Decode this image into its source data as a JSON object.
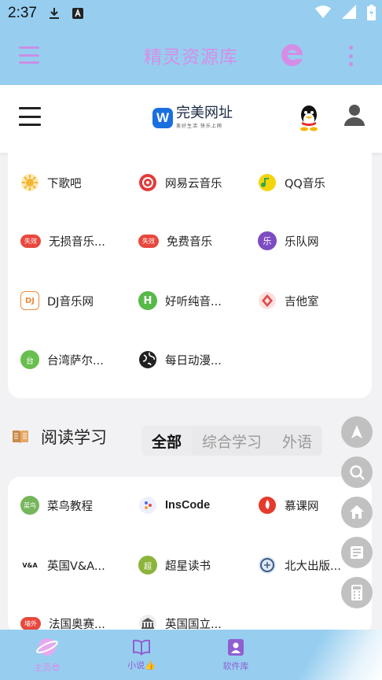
{
  "status_bar": {
    "time": "2:37",
    "icons": [
      "download-icon",
      "a-icon",
      "wifi-icon",
      "signal-icon",
      "battery-icon"
    ]
  },
  "app_bar": {
    "title": "精灵资源库",
    "menu_icon": "hamburger-icon",
    "browser_icon": "edge-browser-icon",
    "more_icon": "more-vertical-icon"
  },
  "web_header": {
    "logo_mark": "W",
    "logo_name": "完美网址",
    "logo_slogan": "美好生活 快乐上网",
    "menu_icon": "hamburger-icon",
    "qq_icon": "qq-penguin-icon",
    "user_icon": "user-icon"
  },
  "music": {
    "items": [
      {
        "label": "下歌吧",
        "icon": "sun-icon",
        "icon_text": "",
        "color": "#f3b431"
      },
      {
        "label": "网易云音乐",
        "icon": "netease-music-icon",
        "icon_text": "",
        "color": "#e13b3b"
      },
      {
        "label": "QQ音乐",
        "icon": "qq-music-icon",
        "icon_text": "",
        "color": "#f4d50c"
      },
      {
        "label": "无损音乐...",
        "icon": "invalid-badge-icon",
        "icon_text": "失效",
        "color": "#e8483e"
      },
      {
        "label": "免费音乐",
        "icon": "invalid-badge-icon",
        "icon_text": "失效",
        "color": "#e8483e"
      },
      {
        "label": "乐队网",
        "icon": "band-icon",
        "icon_text": "乐",
        "color": "#7d4bc2"
      },
      {
        "label": "DJ音乐网",
        "icon": "dj-icon",
        "icon_text": "DJ",
        "color": "#f08a3b"
      },
      {
        "label": "好听纯音...",
        "icon": "h-icon",
        "icon_text": "H",
        "color": "#57b949"
      },
      {
        "label": "吉他室",
        "icon": "guitar-room-icon",
        "icon_text": "",
        "color": "#e34a4a"
      },
      {
        "label": "台湾萨尔...",
        "icon": "taiwan-icon",
        "icon_text": "台",
        "color": "#68bf4f"
      },
      {
        "label": "每日动漫...",
        "icon": "globe-icon",
        "icon_text": "",
        "color": "#222222"
      }
    ]
  },
  "reading": {
    "section_title": "阅读学习",
    "section_icon": "book-icon",
    "tabs": [
      {
        "label": "全部",
        "active": true
      },
      {
        "label": "综合学习",
        "active": false
      },
      {
        "label": "外语",
        "active": false
      }
    ],
    "items": [
      {
        "label": "菜鸟教程",
        "icon": "runoob-icon",
        "icon_text": "菜鸟",
        "color": "#76b65b"
      },
      {
        "label": "InsCode",
        "icon": "inscode-icon",
        "icon_text": "",
        "color": "#5468e8"
      },
      {
        "label": "慕课网",
        "icon": "imooc-icon",
        "icon_text": "",
        "color": "#e53b2c"
      },
      {
        "label": "英国V&A...",
        "icon": "va-icon",
        "icon_text": "V&A",
        "color": "#222222"
      },
      {
        "label": "超星读书",
        "icon": "chaoxing-icon",
        "icon_text": "超",
        "color": "#8db43b"
      },
      {
        "label": "北大出版...",
        "icon": "pku-icon",
        "icon_text": "",
        "color": "#3a5a8a"
      },
      {
        "label": "法国奥赛...",
        "icon": "wall-badge-icon",
        "icon_text": "墙外",
        "color": "#e8483e"
      },
      {
        "label": "英国国立...",
        "icon": "museum-icon",
        "icon_text": "",
        "color": "#555555"
      }
    ]
  },
  "fabs": [
    "navigate-icon",
    "search-icon",
    "home-icon",
    "reader-icon",
    "calculator-icon"
  ],
  "bottom_nav": [
    {
      "label": "主页😎",
      "icon": "home-planet-icon"
    },
    {
      "label": "小说👍",
      "icon": "open-book-icon"
    },
    {
      "label": "软件库",
      "icon": "software-icon"
    }
  ]
}
